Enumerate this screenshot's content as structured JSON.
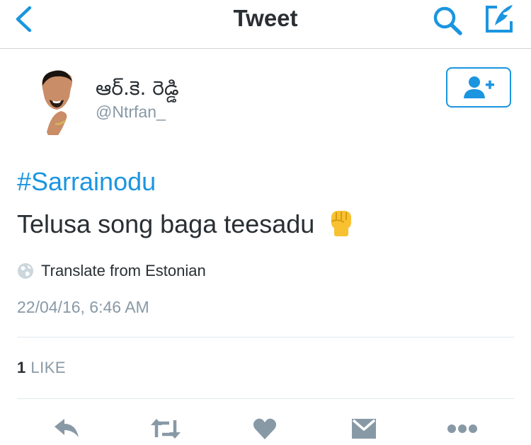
{
  "navbar": {
    "title": "Tweet",
    "back_icon": "chevron-left-icon",
    "search_icon": "search-icon",
    "compose_icon": "compose-icon",
    "accent_color": "#1b95e0"
  },
  "author": {
    "display_name": "ఆర్.కె. రెడ్డి",
    "username": "@Ntrfan_",
    "avatar": "avatar-photo",
    "follow_icon": "follow-user-icon"
  },
  "tweet": {
    "hashtag": "#Sarrainodu",
    "text": "Telusa song baga teesadu",
    "emoji": "raised-fist-emoji",
    "translate_label": "Translate from Estonian",
    "timestamp": "22/04/16, 6:46 AM"
  },
  "stats": {
    "like_count": "1",
    "like_label": "LIKE"
  },
  "actions": [
    {
      "name": "reply-icon"
    },
    {
      "name": "retweet-icon"
    },
    {
      "name": "like-icon"
    },
    {
      "name": "direct-message-icon"
    },
    {
      "name": "more-icon"
    }
  ],
  "colors": {
    "primary_text": "#292f33",
    "secondary_text": "#8899a6",
    "action_icon": "#8899a6"
  }
}
